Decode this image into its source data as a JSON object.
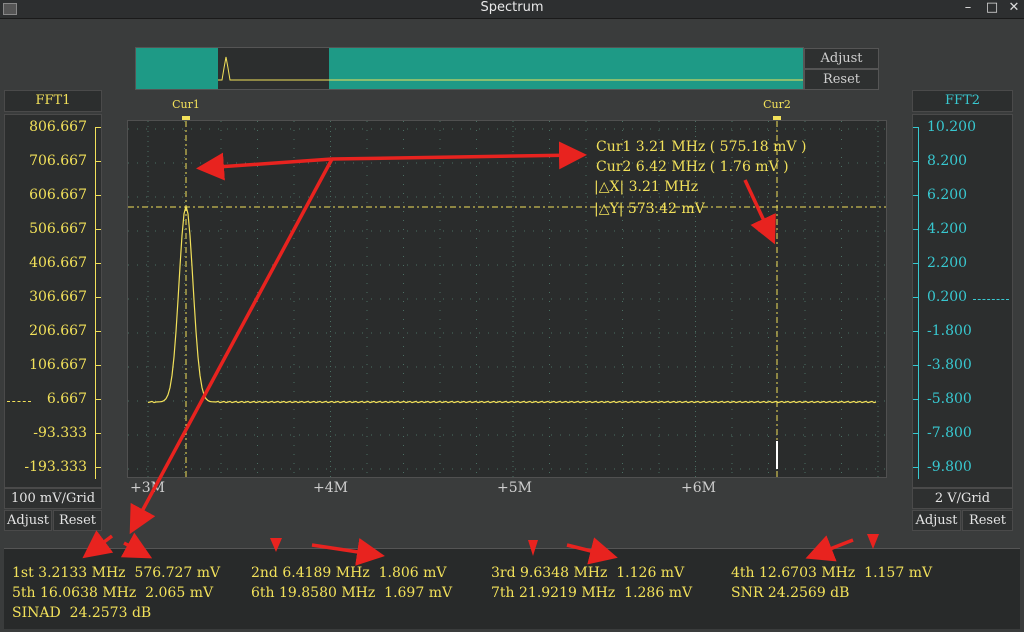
{
  "window": {
    "title": "Spectrum"
  },
  "overview": {
    "adjust_label": "Adjust",
    "reset_label": "Reset"
  },
  "left_axis": {
    "title": "FFT1",
    "ticks": [
      "806.667",
      "706.667",
      "606.667",
      "506.667",
      "406.667",
      "306.667",
      "206.667",
      "106.667",
      "6.667",
      "-93.333",
      "-193.333"
    ],
    "scale": "100 mV/Grid",
    "adjust_label": "Adjust",
    "reset_label": "Reset"
  },
  "right_axis": {
    "title": "FFT2",
    "ticks": [
      "10.200",
      "8.200",
      "6.200",
      "4.200",
      "2.200",
      "0.200",
      "-1.800",
      "-3.800",
      "-5.800",
      "-7.800",
      "-9.800"
    ],
    "scale": "2 V/Grid",
    "adjust_label": "Adjust",
    "reset_label": "Reset"
  },
  "plot": {
    "x_ticks": [
      "+3M",
      "+4M",
      "+5M",
      "+6M"
    ],
    "cursor1_label": "Cur1",
    "cursor2_label": "Cur2",
    "readout": {
      "cur1": "Cur1   3.21 MHz ( 575.18 mV )",
      "cur2": "Cur2   6.42 MHz ( 1.76 mV )",
      "dx": "|△X|   3.21 MHz",
      "dy": "|△Y|  573.42 mV"
    }
  },
  "measurements": {
    "h1": "1st 3.2133 MHz  576.727 mV",
    "h2": "2nd 6.4189 MHz  1.806 mV",
    "h3": "3rd 9.6348 MHz  1.126 mV",
    "h4": "4th 12.6703 MHz  1.157 mV",
    "h5": "5th 16.0638 MHz  2.065 mV",
    "h6": "6th 19.8580 MHz  1.697 mV",
    "h7": "7th 21.9219 MHz  1.286 mV",
    "snr": "SNR 24.2569 dB",
    "sinad": "SINAD  24.2573 dB"
  },
  "colors": {
    "trace": "#f2e15a",
    "fft2_axis": "#38c8d0",
    "annotation": "#e8231f",
    "overview": "#1e9a86"
  }
}
